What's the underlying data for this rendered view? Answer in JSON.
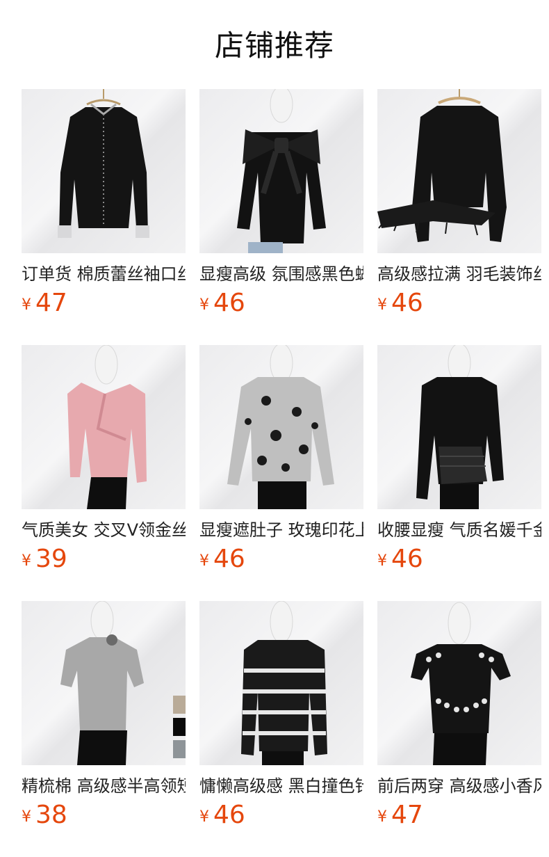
{
  "header": {
    "title": "店铺推荐"
  },
  "currency": "¥",
  "products": [
    {
      "name": "订单货 棉质蕾丝袖口丝绒衬衫",
      "price": "47",
      "icon": "velvet-shirt-icon"
    },
    {
      "name": "显瘦高级 氛围感黑色蝴蝶结上衣",
      "price": "46",
      "icon": "bow-top-icon"
    },
    {
      "name": "高级感拉满 羽毛装饰丝绒上衣",
      "price": "46",
      "icon": "feather-top-icon"
    },
    {
      "name": "气质美女 交叉V领金丝绒上衣",
      "price": "39",
      "icon": "pink-wrap-top-icon"
    },
    {
      "name": "显瘦遮肚子 玫瑰印花上衣",
      "price": "46",
      "icon": "floral-top-icon"
    },
    {
      "name": "收腰显瘦 气质名媛千金上衣",
      "price": "46",
      "icon": "black-top-icon"
    },
    {
      "name": "精梳棉 高级感半高领短袖T恤",
      "price": "38",
      "icon": "grey-tee-icon"
    },
    {
      "name": "慵懒高级感 黑白撞色针织开衫",
      "price": "46",
      "icon": "knit-cardigan-icon"
    },
    {
      "name": "前后两穿 高级感小香风针织衫",
      "price": "47",
      "icon": "tweed-knit-icon"
    }
  ]
}
